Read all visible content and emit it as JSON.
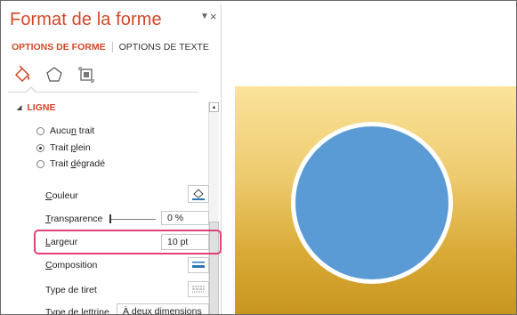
{
  "pane": {
    "title": "Format de la forme",
    "dropdown_icon": "triangle-down",
    "close_glyph": "×",
    "tabs": [
      {
        "label": "OPTIONS DE FORME",
        "active": true
      },
      {
        "label": "OPTIONS DE TEXTE",
        "active": false
      }
    ],
    "icons": [
      "fill-line-icon",
      "effects-pentagon-icon",
      "size-properties-icon"
    ],
    "section": {
      "label": "LIGNE",
      "expanded": true
    },
    "line_options": [
      {
        "label_pre": "Aucu",
        "label_ul": "n",
        "label_post": " trait",
        "checked": false
      },
      {
        "label_pre": "Trait ",
        "label_ul": "p",
        "label_post": "lein",
        "checked": true
      },
      {
        "label_pre": "Trait ",
        "label_ul": "d",
        "label_post": "égradé",
        "checked": false
      }
    ],
    "properties": {
      "couleur": {
        "ul": "C",
        "rest": "ouleur"
      },
      "transparence": {
        "ul": "T",
        "rest": "ransparence",
        "value": "0 %"
      },
      "largeur": {
        "ul": "L",
        "rest": "argeur",
        "value": "10  pt"
      },
      "composition": {
        "ul": "C",
        "rest": "omposition"
      },
      "type_tiret": {
        "label": "Type de tiret"
      },
      "type_lettrine": {
        "pre": "Type de ",
        "ul": "l",
        "post": "ettrine",
        "value": "À deux dimensions"
      }
    }
  },
  "colors": {
    "accent": "#d24726",
    "highlight": "#e0417a",
    "circle_fill": "#5b9bd5",
    "slide_gradient_top": "#fbe39a",
    "slide_gradient_bottom": "#c7951e"
  }
}
